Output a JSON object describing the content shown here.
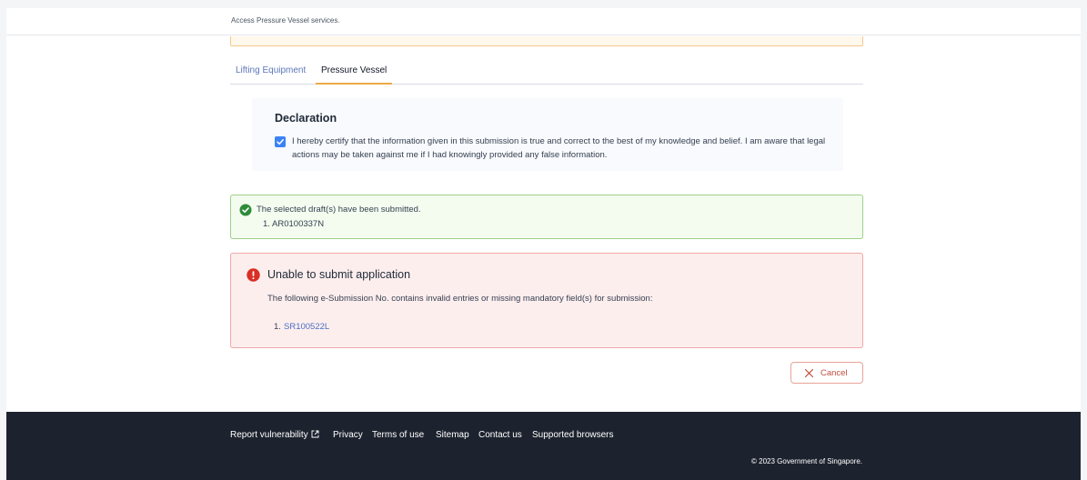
{
  "topbar": {
    "text": "Access Pressure Vessel services."
  },
  "tabs": [
    {
      "label": "Lifting Equipment",
      "active": false
    },
    {
      "label": "Pressure Vessel",
      "active": true
    }
  ],
  "declaration": {
    "title": "Declaration",
    "checked": true,
    "text": "I hereby certify that the information given in this submission is true and correct to the best of my knowledge and belief. I am aware that legal actions may be taken against me if I had knowingly provided any false information."
  },
  "success": {
    "message": "The selected draft(s) have been submitted.",
    "items": [
      "1. AR0100337N"
    ],
    "color": "#2e8b3a"
  },
  "error": {
    "title": "Unable to submit application",
    "message": "The following e-Submission No. contains invalid entries or missing mandatory field(s) for submission:",
    "item_number": "1.",
    "item_link": "SR100522L",
    "color": "#d93025"
  },
  "actions": {
    "cancel_label": "Cancel"
  },
  "footer": {
    "links": [
      "Report vulnerability",
      "Privacy",
      "Terms of use",
      "Sitemap",
      "Contact us",
      "Supported browsers"
    ],
    "copyright": "© 2023 Government of Singapore."
  }
}
